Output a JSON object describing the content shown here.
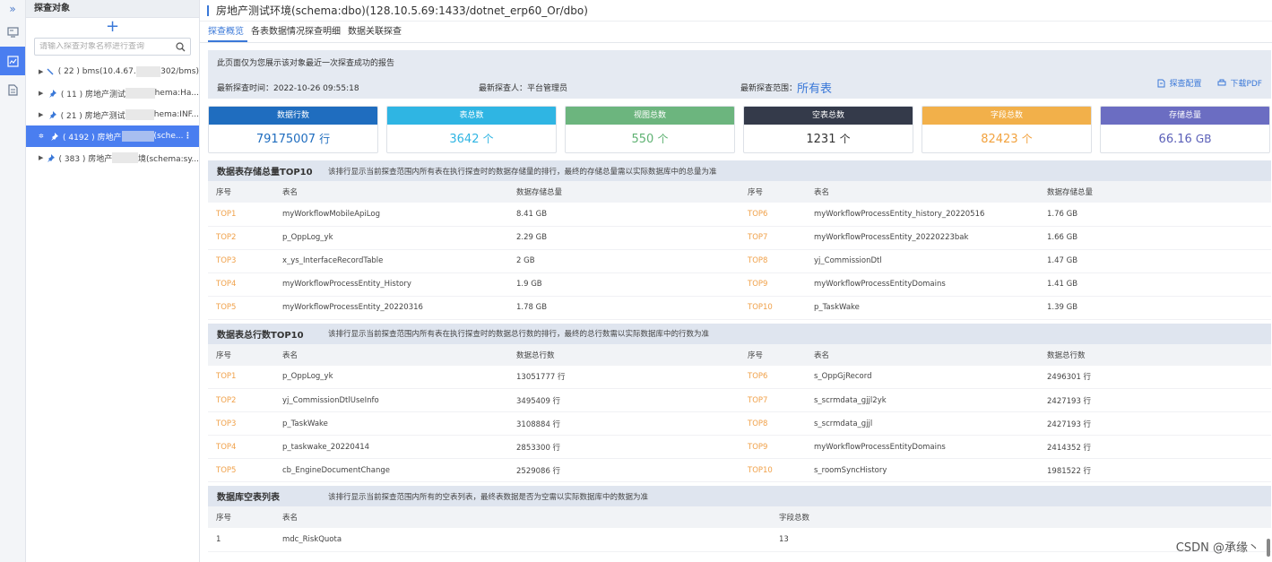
{
  "tree": {
    "header": "探查对象",
    "add_label": "+",
    "search_placeholder": "请输入探查对象名称进行查询",
    "nodes": [
      {
        "prefix": "( 22 ) bms(10.4.67.",
        "suffix": "302/bms)"
      },
      {
        "prefix": "( 11 ) 房地产测试",
        "suffix": "hema:Ha..."
      },
      {
        "prefix": "( 21 ) 房地产测试",
        "suffix": "hema:INF..."
      },
      {
        "prefix": "( 4192 ) 房地产",
        "suffix": "(sche...",
        "more": "⋮"
      },
      {
        "prefix": "( 383 ) 房地产",
        "suffix": "境(schema:sy..."
      }
    ]
  },
  "header": {
    "title": "房地产测试环境(schema:dbo)(128.10.5.69:1433/dotnet_erp60_Or/dbo)"
  },
  "tabs": [
    "探查概览",
    "各表数据情况探查明细",
    "数据关联探查"
  ],
  "info": {
    "notice": "此页面仅为您展示该对象最近一次探查成功的报告",
    "time": "最新探查时间：2022-10-26 09:55:18",
    "person": "最新探查人：平台管理员",
    "scope_label": "最新探查范围：",
    "scope_value": "所有表",
    "config_label": "探查配置",
    "pdf_label": "下载PDF"
  },
  "cards": [
    {
      "label": "数据行数",
      "value": "79175007",
      "unit": "行",
      "color": "#1f6dbf",
      "value_color": "#1f6dbf"
    },
    {
      "label": "表总数",
      "value": "3642",
      "unit": "个",
      "color": "#2fb5e3",
      "value_color": "#2fb5e3"
    },
    {
      "label": "视图总数",
      "value": "550",
      "unit": "个",
      "color": "#6cb57e",
      "value_color": "#5fb273"
    },
    {
      "label": "空表总数",
      "value": "1231",
      "unit": "个",
      "color": "#343a4a",
      "value_color": "#333333"
    },
    {
      "label": "字段总数",
      "value": "82423",
      "unit": "个",
      "color": "#f2b04a",
      "value_color": "#f2a23e"
    },
    {
      "label": "存储总量",
      "value": "66.16",
      "unit": "GB",
      "color": "#6b6dc2",
      "value_color": "#5a5fb8"
    }
  ],
  "storage": {
    "title": "数据表存储总量TOP10",
    "desc": "该排行显示当前探查范围内所有表在执行探查时的数据存储量的排行，最终的存储总量需以实际数据库中的总量为准",
    "headers": [
      "序号",
      "表名",
      "数据存储总量",
      "序号",
      "表名",
      "数据存储总量"
    ],
    "rows": [
      [
        "TOP1",
        "myWorkflowMobileApiLog",
        "8.41 GB",
        "TOP6",
        "myWorkflowProcessEntity_history_20220516",
        "1.76 GB"
      ],
      [
        "TOP2",
        "p_OppLog_yk",
        "2.29 GB",
        "TOP7",
        "myWorkflowProcessEntity_20220223bak",
        "1.66 GB"
      ],
      [
        "TOP3",
        "x_ys_InterfaceRecordTable",
        "2 GB",
        "TOP8",
        "yj_CommissionDtl",
        "1.47 GB"
      ],
      [
        "TOP4",
        "myWorkflowProcessEntity_History",
        "1.9 GB",
        "TOP9",
        "myWorkflowProcessEntityDomains",
        "1.41 GB"
      ],
      [
        "TOP5",
        "myWorkflowProcessEntity_20220316",
        "1.78 GB",
        "TOP10",
        "p_TaskWake",
        "1.39 GB"
      ]
    ]
  },
  "rows_top": {
    "title": "数据表总行数TOP10",
    "desc": "该排行显示当前探查范围内所有表在执行探查时的数据总行数的排行，最终的总行数需以实际数据库中的行数为准",
    "headers": [
      "序号",
      "表名",
      "数据总行数",
      "序号",
      "表名",
      "数据总行数"
    ],
    "rows": [
      [
        "TOP1",
        "p_OppLog_yk",
        "13051777 行",
        "TOP6",
        "s_OppGjRecord",
        "2496301 行"
      ],
      [
        "TOP2",
        "yj_CommissionDtlUseInfo",
        "3495409 行",
        "TOP7",
        "s_scrmdata_gjjl2yk",
        "2427193 行"
      ],
      [
        "TOP3",
        "p_TaskWake",
        "3108884 行",
        "TOP8",
        "s_scrmdata_gjjl",
        "2427193 行"
      ],
      [
        "TOP4",
        "p_taskwake_20220414",
        "2853300 行",
        "TOP9",
        "myWorkflowProcessEntityDomains",
        "2414352 行"
      ],
      [
        "TOP5",
        "cb_EngineDocumentChange",
        "2529086 行",
        "TOP10",
        "s_roomSyncHistory",
        "1981522 行"
      ]
    ]
  },
  "empty": {
    "title": "数据库空表列表",
    "desc": "该排行显示当前探查范围内所有的空表列表，最终表数据是否为空需以实际数据库中的数据为准",
    "headers": [
      "序号",
      "表名",
      "字段总数"
    ],
    "rows": [
      [
        "1",
        "mdc_RiskQuota",
        "13"
      ]
    ]
  },
  "watermark": "CSDN @承缘丶"
}
